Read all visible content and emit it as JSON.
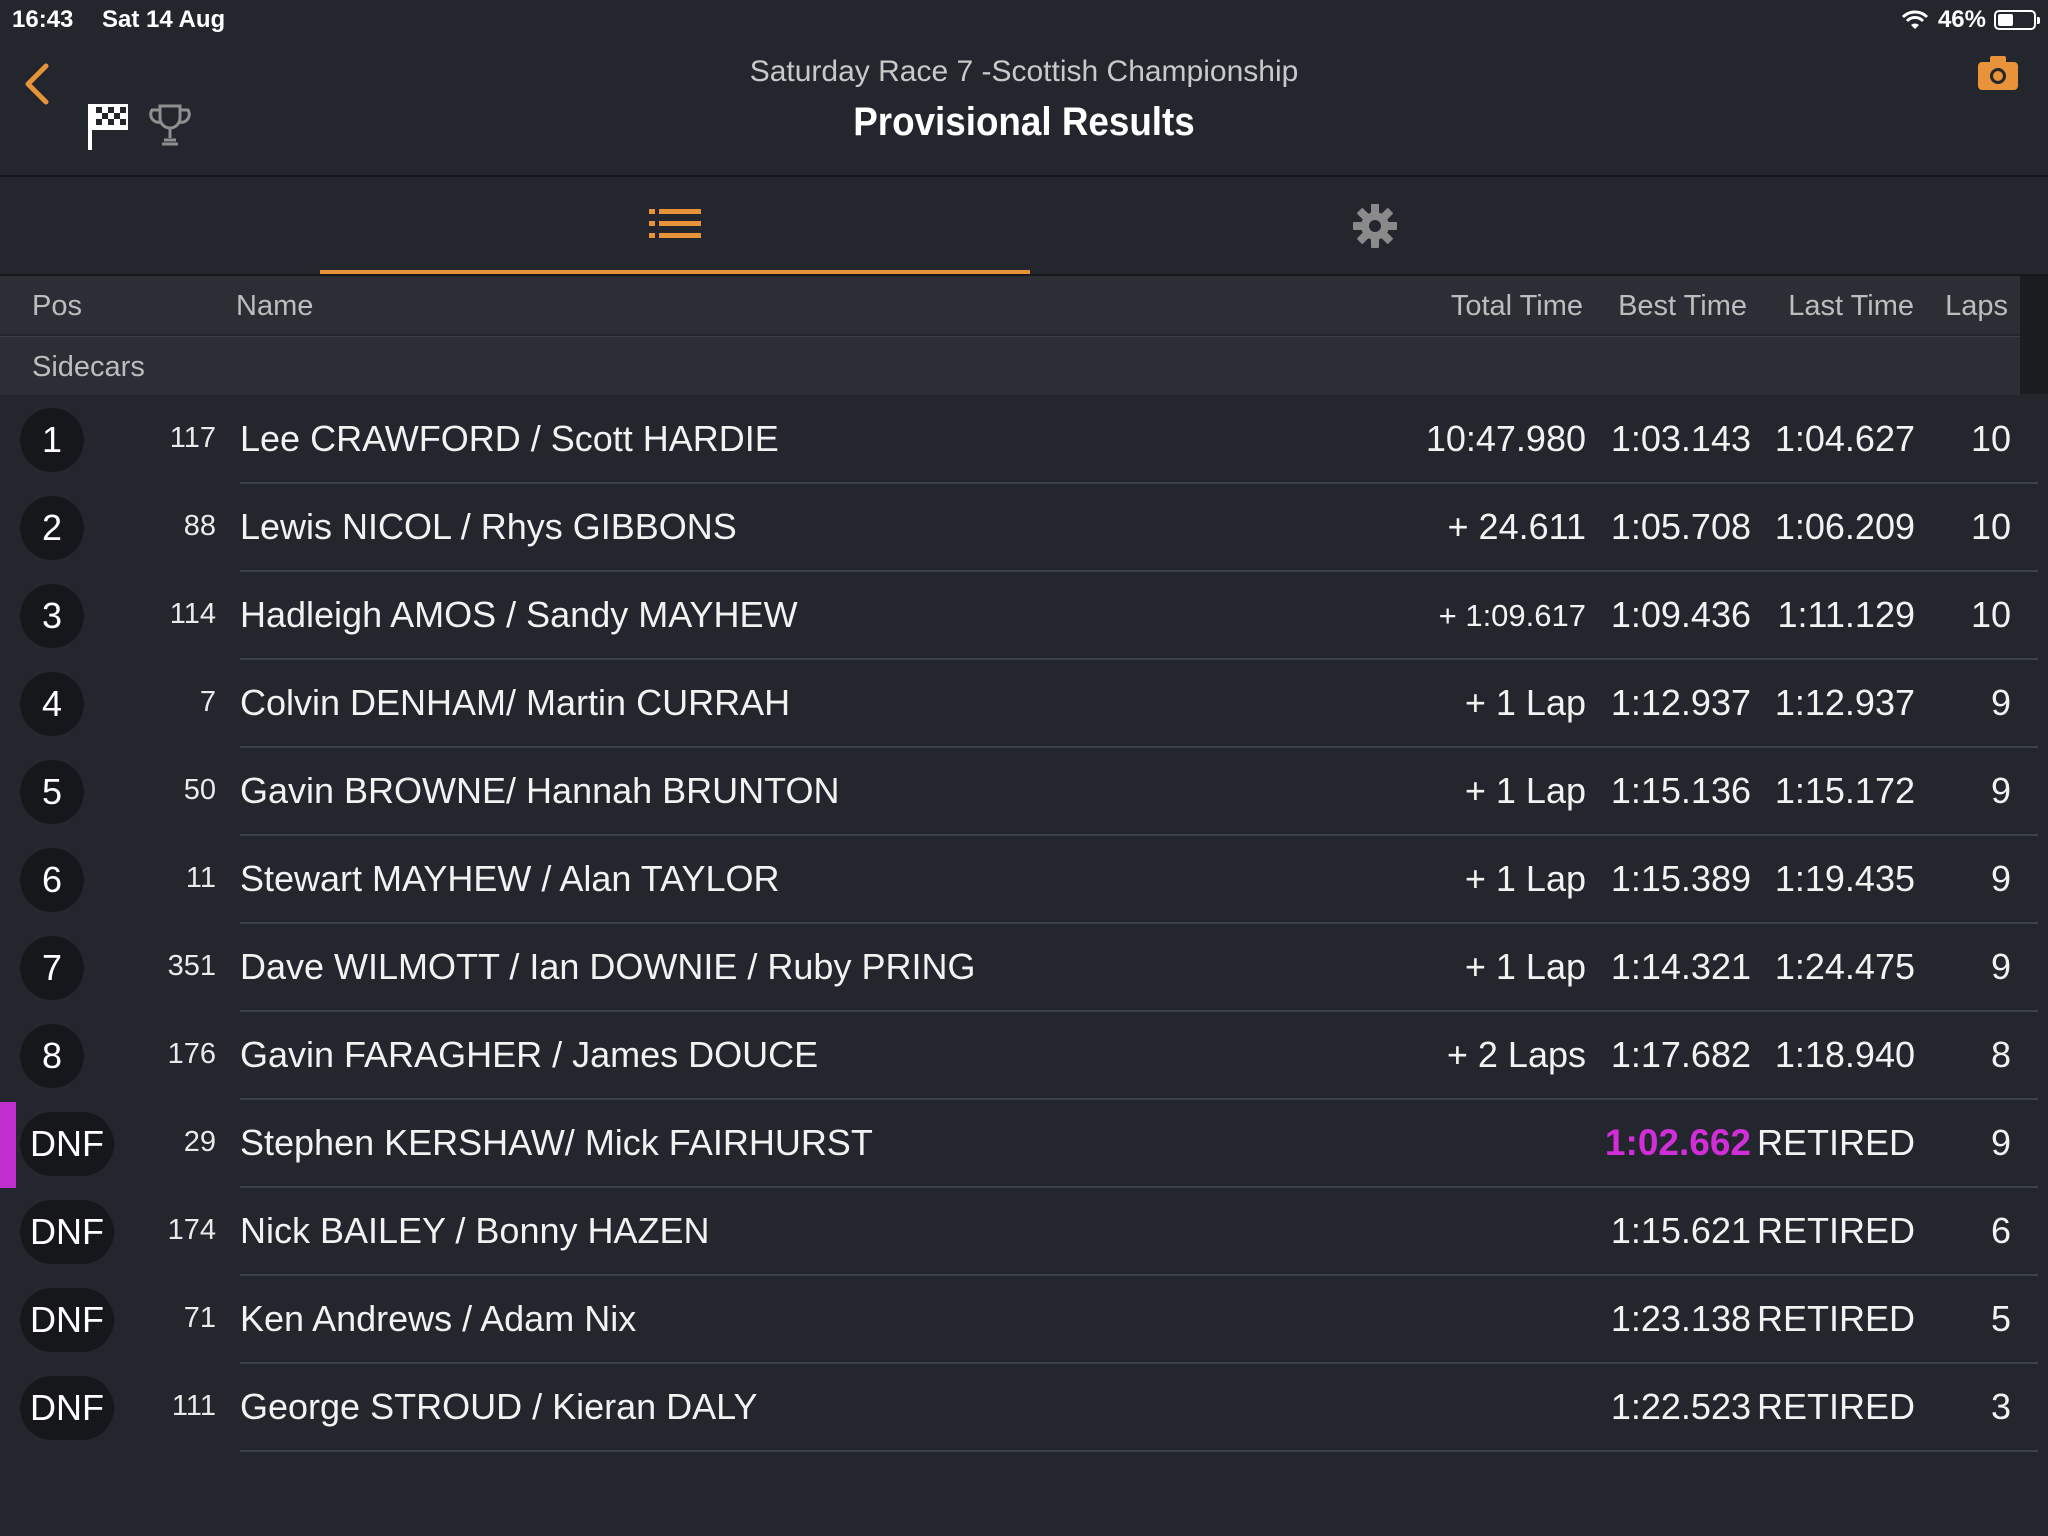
{
  "status_bar": {
    "time": "16:43",
    "date": "Sat 14 Aug",
    "battery": "46%"
  },
  "header": {
    "subtitle": "Saturday Race 7 -Scottish Championship",
    "title": "Provisional Results"
  },
  "columns": {
    "pos": "Pos",
    "name": "Name",
    "total": "Total Time",
    "best": "Best Time",
    "last": "Last Time",
    "laps": "Laps"
  },
  "group_label": "Sidecars",
  "colors": {
    "accent": "#e8923a",
    "fastest": "#d12ed9",
    "background": "#23262d"
  },
  "rows": [
    {
      "pos": "1",
      "num": "117",
      "name": "Lee CRAWFORD / Scott HARDIE",
      "total": "10:47.980",
      "best": "1:03.143",
      "last": "1:04.627",
      "laps": "10"
    },
    {
      "pos": "2",
      "num": "88",
      "name": "Lewis NICOL / Rhys GIBBONS",
      "total": "+ 24.611",
      "best": "1:05.708",
      "last": "1:06.209",
      "laps": "10"
    },
    {
      "pos": "3",
      "num": "114",
      "name": "Hadleigh AMOS / Sandy MAYHEW",
      "total": "+ 1:09.617",
      "best": "1:09.436",
      "last": "1:11.129",
      "laps": "10"
    },
    {
      "pos": "4",
      "num": "7",
      "name": "Colvin DENHAM/ Martin CURRAH",
      "total": "+ 1 Lap",
      "best": "1:12.937",
      "last": "1:12.937",
      "laps": "9"
    },
    {
      "pos": "5",
      "num": "50",
      "name": "Gavin BROWNE/ Hannah BRUNTON",
      "total": "+ 1 Lap",
      "best": "1:15.136",
      "last": "1:15.172",
      "laps": "9"
    },
    {
      "pos": "6",
      "num": "11",
      "name": "Stewart MAYHEW / Alan TAYLOR",
      "total": "+ 1 Lap",
      "best": "1:15.389",
      "last": "1:19.435",
      "laps": "9"
    },
    {
      "pos": "7",
      "num": "351",
      "name": "Dave WILMOTT / Ian DOWNIE / Ruby PRING",
      "total": "+ 1 Lap",
      "best": "1:14.321",
      "last": "1:24.475",
      "laps": "9"
    },
    {
      "pos": "8",
      "num": "176",
      "name": "Gavin FARAGHER / James DOUCE",
      "total": "+ 2 Laps",
      "best": "1:17.682",
      "last": "1:18.940",
      "laps": "8"
    },
    {
      "pos": "DNF",
      "num": "29",
      "name": "Stephen KERSHAW/ Mick FAIRHURST",
      "total": "",
      "best": "1:02.662",
      "last": "RETIRED",
      "laps": "9"
    },
    {
      "pos": "DNF",
      "num": "174",
      "name": "Nick BAILEY / Bonny HAZEN",
      "total": "",
      "best": "1:15.621",
      "last": "RETIRED",
      "laps": "6"
    },
    {
      "pos": "DNF",
      "num": "71",
      "name": "Ken Andrews / Adam Nix",
      "total": "",
      "best": "1:23.138",
      "last": "RETIRED",
      "laps": "5"
    },
    {
      "pos": "DNF",
      "num": "111",
      "name": "George STROUD / Kieran DALY",
      "total": "",
      "best": "1:22.523",
      "last": "RETIRED",
      "laps": "3"
    }
  ]
}
